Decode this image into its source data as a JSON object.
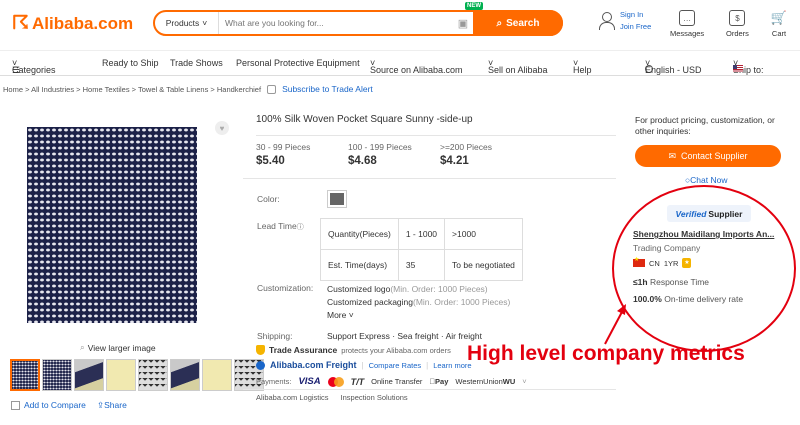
{
  "header": {
    "logo_text": "Alibaba.com",
    "search_category": "Products",
    "search_placeholder": "What are you looking for...",
    "new_badge": "NEW",
    "search_button": "Search",
    "sign_in": "Sign In",
    "join_free": "Join Free",
    "messages": "Messages",
    "orders": "Orders",
    "cart": "Cart"
  },
  "nav": {
    "categories": "Categories",
    "ready_to_ship": "Ready to Ship",
    "trade_shows": "Trade Shows",
    "ppe": "Personal Protective Equipment",
    "source_on": "Source on Alibaba.com",
    "sell_on": "Sell on Alibaba",
    "help": "Help",
    "language": "English - USD",
    "ship_to": "Ship to:"
  },
  "breadcrumb": {
    "text": "Home > All Industries > Home Textiles > Towel & Table Linens > Handkerchief",
    "alert": "Subscribe to Trade Alert"
  },
  "gallery": {
    "view_larger": "View larger image",
    "add_to_compare": "Add to Compare",
    "share": "Share"
  },
  "product": {
    "title": "100% Silk Woven Pocket Square Sunny -side-up",
    "tiers": [
      {
        "qty": "30 - 99 Pieces",
        "price": "$5.40"
      },
      {
        "qty": "100 - 199 Pieces",
        "price": "$4.68"
      },
      {
        "qty": ">=200 Pieces",
        "price": "$4.21"
      }
    ],
    "color_label": "Color:",
    "lead_time_label": "Lead Time",
    "lead_table": {
      "h1": "Quantity(Pieces)",
      "h2": "1 - 1000",
      "h3": ">1000",
      "r1": "Est. Time(days)",
      "r2": "35",
      "r3": "To be negotiated"
    },
    "customization_label": "Customization:",
    "custom_logo": "Customized logo",
    "custom_logo_min": "(Min. Order: 1000 Pieces)",
    "custom_pack": "Customized packaging",
    "custom_pack_min": "(Min. Order: 1000 Pieces)",
    "more": "More",
    "shipping_label": "Shipping:",
    "shipping_value": "Support Express · Sea freight · Air freight",
    "trade_assurance": "Trade Assurance",
    "trade_assurance_sub": "protects your Alibaba.com orders",
    "freight": "Alibaba.com Freight",
    "compare_rates": "Compare Rates",
    "learn_more": "Learn more",
    "payments_label": "Payments:",
    "pay_visa": "VISA",
    "pay_tt": "T/T",
    "pay_online": "Online Transfer",
    "pay_apple": "Pay",
    "pay_wu": "WesternUnion",
    "pay_wu2": "WU",
    "logistics": "Alibaba.com Logistics",
    "inspection": "Inspection Solutions"
  },
  "right": {
    "inquiry": "For product pricing, customization, or other inquiries:",
    "contact": "Contact Supplier",
    "chat": "Chat Now",
    "verified_v": "Verified",
    "verified_s": "Supplier",
    "supplier_name": "Shengzhou Maidilang Imports An...",
    "supplier_type": "Trading Company",
    "country": "CN",
    "years": "1YR",
    "response": "≤1h",
    "response_label": "Response Time",
    "ontime": "100.0%",
    "ontime_label": "On-time delivery rate"
  },
  "annotation": "High level company metrics",
  "colors": {
    "brand": "#ff6a00",
    "link": "#1a66c9",
    "annotation": "#e3000f"
  }
}
